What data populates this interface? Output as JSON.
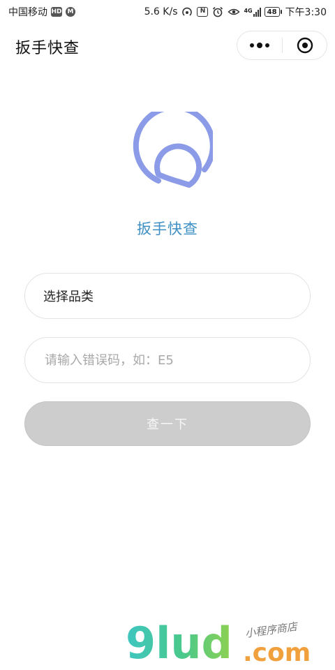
{
  "status_bar": {
    "carrier": "中国移动",
    "hd_badge": "HD",
    "m_badge": "M",
    "net_speed": "5.6 K/s",
    "nfc_badge": "N",
    "net_type_badge": "4G",
    "battery": "48",
    "time": "下午3:30"
  },
  "navbar": {
    "title": "扳手快查"
  },
  "logo": {
    "app_name": "扳手快查",
    "color": "#8b9be8"
  },
  "form": {
    "category_picker_label": "选择品类",
    "error_code_placeholder": "请输入错误码，如：E5",
    "error_code_value": "",
    "query_button_label": "查一下"
  },
  "watermark": {
    "brand": "9lud",
    "domain": ".com",
    "slogan": "小程序商店"
  },
  "colors": {
    "accent_text": "#3d8fc4",
    "logo": "#8b9be8",
    "button_disabled": "#cdcdcd"
  }
}
